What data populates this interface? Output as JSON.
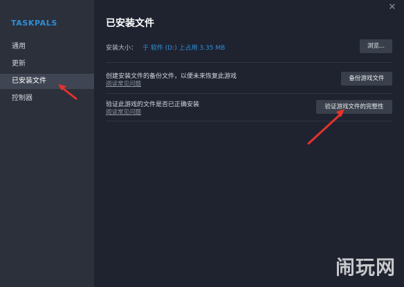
{
  "app": {
    "title": "TASKPALS"
  },
  "sidebar": {
    "items": [
      {
        "label": "通用",
        "active": false
      },
      {
        "label": "更新",
        "active": false
      },
      {
        "label": "已安装文件",
        "active": true
      },
      {
        "label": "控制器",
        "active": false
      }
    ]
  },
  "main": {
    "title": "已安装文件",
    "install_size_label": "安装大小：",
    "install_size_value": "于 软件 (D:) 上占用 3.35 MB",
    "browse_button": "浏览...",
    "backup": {
      "text": "创建安装文件的备份文件，以便未来恢复此游戏",
      "link": "阅读常见问题",
      "button": "备份游戏文件"
    },
    "verify": {
      "text": "验证此游戏的文件是否已正确安装",
      "link": "阅读常见问题",
      "button": "验证游戏文件的完整性"
    }
  },
  "watermark": {
    "text": "闹玩网"
  },
  "colors": {
    "accent": "#2f8fd8",
    "arrow": "#e5322d"
  }
}
